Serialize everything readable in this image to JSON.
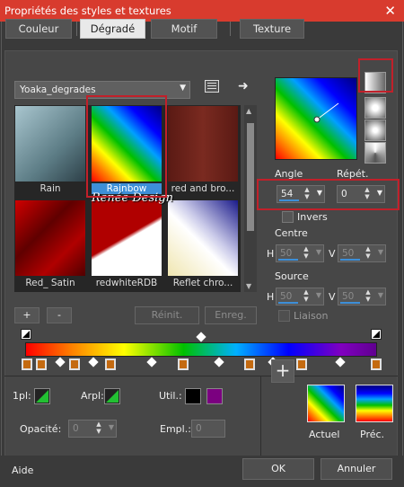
{
  "window": {
    "title": "Propriétés des styles et textures",
    "close": "✕"
  },
  "tabs": [
    {
      "label": "Couleur",
      "active": false
    },
    {
      "label": "Dégradé",
      "active": true
    },
    {
      "label": "Motif",
      "active": false
    },
    {
      "label": "Texture",
      "active": false
    }
  ],
  "library": {
    "selected": "Yoaka_degrades"
  },
  "swatches": [
    {
      "label": "Rain"
    },
    {
      "label": "Rainbow"
    },
    {
      "label": "red and bro..."
    },
    {
      "label": "Red_ Satin"
    },
    {
      "label": "redwhiteRDB"
    },
    {
      "label": "Reflet chro..."
    }
  ],
  "watermark": "Renée Design",
  "buttons": {
    "add": "+",
    "remove": "-",
    "reset": "Réinit.",
    "save": "Enreg.",
    "ok": "OK",
    "cancel": "Annuler",
    "help": "Aide"
  },
  "angle": {
    "label": "Angle",
    "value": "54"
  },
  "repeat": {
    "label": "Répét.",
    "value": "0"
  },
  "invert": {
    "label": "Invers",
    "checked": false
  },
  "center": {
    "label": "Centre",
    "h_label": "H",
    "h_value": "50",
    "v_label": "V",
    "v_value": "50"
  },
  "source": {
    "label": "Source",
    "h_label": "H",
    "h_value": "50",
    "v_label": "V",
    "v_value": "50"
  },
  "link": {
    "label": "Liaison",
    "checked": false
  },
  "editor": {
    "first_label": "1pl:",
    "arpl_label": "Arpl:",
    "util_label": "Util.:",
    "util_colors": [
      "#000000",
      "#7b0080"
    ],
    "opacity_label": "Opacité:",
    "opacity_value": "0",
    "empl_label": "Empl.:",
    "empl_value": "0"
  },
  "preview": {
    "current": "Actuel",
    "previous": "Préc."
  },
  "accent": "#3d8fd8",
  "highlight": "#c1202a"
}
